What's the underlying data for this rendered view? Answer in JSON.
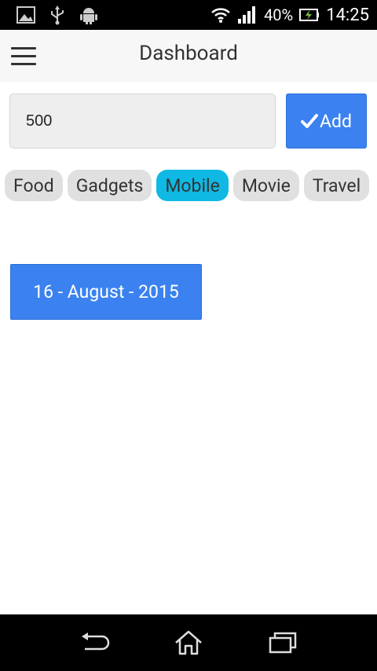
{
  "status_bar": {
    "battery": "40%",
    "time": "14:25",
    "icons": [
      "image-icon",
      "usb-icon",
      "android-icon",
      "wifi-icon",
      "signal-icon",
      "battery-charging-icon"
    ]
  },
  "app_bar": {
    "title": "Dashboard",
    "menu_icon": "hamburger-menu-icon"
  },
  "form": {
    "amount_value": "500",
    "add_label": "Add",
    "add_icon": "checkmark-icon"
  },
  "categories": [
    {
      "label": "Food",
      "active": false
    },
    {
      "label": "Gadgets",
      "active": false
    },
    {
      "label": "Mobile",
      "active": true
    },
    {
      "label": "Movie",
      "active": false
    },
    {
      "label": "Travel",
      "active": false
    }
  ],
  "date_button": {
    "label": "16 - August - 2015"
  },
  "nav_bar": {
    "icons": [
      "back-icon",
      "home-icon",
      "recents-icon"
    ]
  },
  "colors": {
    "accent": "#3b82f0",
    "chip_active": "#0fb9e4",
    "chip_bg": "#e0e0e0"
  }
}
